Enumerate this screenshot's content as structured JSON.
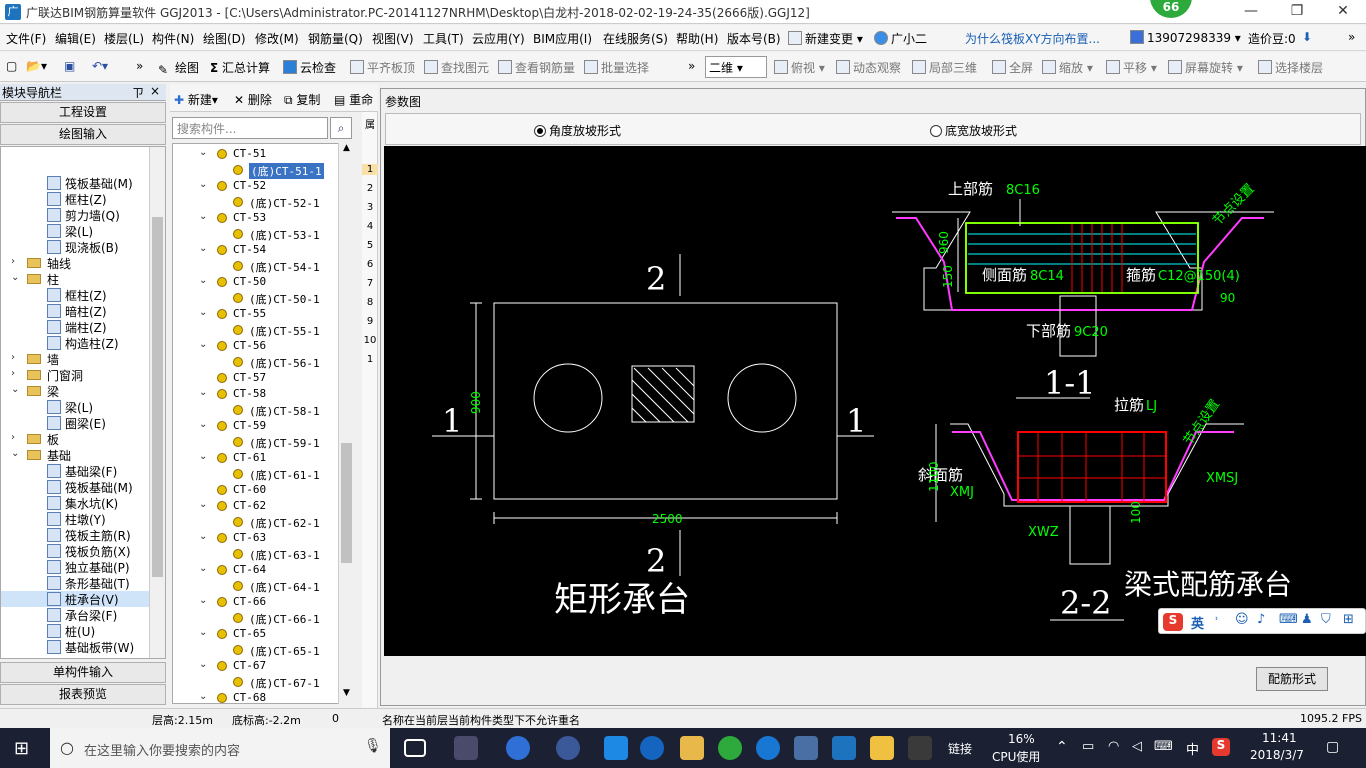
{
  "titlebar": {
    "title": "广联达BIM钢筋算量软件 GGJ2013 - [C:\\Users\\Administrator.PC-20141127NRHM\\Desktop\\白龙村-2018-02-02-19-24-35(2666版).GGJ12]",
    "badge": "66",
    "minimize": "—",
    "restore": "❐",
    "close": "✕"
  },
  "menubar": {
    "items": [
      "文件(F)",
      "编辑(E)",
      "楼层(L)",
      "构件(N)",
      "绘图(D)",
      "修改(M)",
      "钢筋量(Q)",
      "视图(V)",
      "工具(T)",
      "云应用(Y)",
      "BIM应用(I)",
      "在线服务(S)",
      "帮助(H)",
      "版本号(B)"
    ],
    "new_change": "新建变更",
    "assistant": "广小二",
    "question_link": "为什么筏板XY方向布置...",
    "phone": "13907298339",
    "cost_coin": "造价豆:0"
  },
  "toolbar": {
    "draw": "绘图",
    "sum": "汇总计算",
    "cloud_check": "云检查",
    "align_top": "平齐板顶",
    "find_element": "查找图元",
    "view_rebar": "查看钢筋量",
    "batch_select": "批量选择",
    "view_mode": "二维",
    "top_view": "俯视",
    "dynamic": "动态观察",
    "local_3d": "局部三维",
    "fullscreen": "全屏",
    "zoom": "缩放",
    "pan": "平移",
    "rotate": "屏幕旋转",
    "select_floor": "选择楼层"
  },
  "nav": {
    "header": "模块导航栏",
    "pin": "ㄗ",
    "close": "×",
    "project_settings": "工程设置",
    "draw_input": "绘图输入",
    "single_input": "单构件输入",
    "report_preview": "报表预览",
    "tree": [
      {
        "level": 2,
        "type": "item",
        "label": "筏板基础(M)"
      },
      {
        "level": 2,
        "type": "item",
        "label": "框柱(Z)"
      },
      {
        "level": 2,
        "type": "item",
        "label": "剪力墙(Q)"
      },
      {
        "level": 2,
        "type": "item",
        "label": "梁(L)"
      },
      {
        "level": 2,
        "type": "item",
        "label": "现浇板(B)"
      },
      {
        "level": 1,
        "type": "folder",
        "label": "轴线",
        "open": false
      },
      {
        "level": 1,
        "type": "folder",
        "label": "柱",
        "open": true
      },
      {
        "level": 2,
        "type": "item",
        "label": "框柱(Z)"
      },
      {
        "level": 2,
        "type": "item",
        "label": "暗柱(Z)"
      },
      {
        "level": 2,
        "type": "item",
        "label": "端柱(Z)"
      },
      {
        "level": 2,
        "type": "item",
        "label": "构造柱(Z)"
      },
      {
        "level": 1,
        "type": "folder",
        "label": "墙",
        "open": false
      },
      {
        "level": 1,
        "type": "folder",
        "label": "门窗洞",
        "open": false
      },
      {
        "level": 1,
        "type": "folder",
        "label": "梁",
        "open": true
      },
      {
        "level": 2,
        "type": "item",
        "label": "梁(L)"
      },
      {
        "level": 2,
        "type": "item",
        "label": "圈梁(E)"
      },
      {
        "level": 1,
        "type": "folder",
        "label": "板",
        "open": false
      },
      {
        "level": 1,
        "type": "folder",
        "label": "基础",
        "open": true
      },
      {
        "level": 2,
        "type": "item",
        "label": "基础梁(F)"
      },
      {
        "level": 2,
        "type": "item",
        "label": "筏板基础(M)"
      },
      {
        "level": 2,
        "type": "item",
        "label": "集水坑(K)"
      },
      {
        "level": 2,
        "type": "item",
        "label": "柱墩(Y)"
      },
      {
        "level": 2,
        "type": "item",
        "label": "筏板主筋(R)"
      },
      {
        "level": 2,
        "type": "item",
        "label": "筏板负筋(X)"
      },
      {
        "level": 2,
        "type": "item",
        "label": "独立基础(P)"
      },
      {
        "level": 2,
        "type": "item",
        "label": "条形基础(T)"
      },
      {
        "level": 2,
        "type": "item",
        "label": "桩承台(V)",
        "selected": true
      },
      {
        "level": 2,
        "type": "item",
        "label": "承台梁(F)"
      },
      {
        "level": 2,
        "type": "item",
        "label": "桩(U)"
      },
      {
        "level": 2,
        "type": "item",
        "label": "基础板带(W)"
      }
    ]
  },
  "components": {
    "new": "新建",
    "delete": "删除",
    "copy": "复制",
    "rename": "重命",
    "search_placeholder": "搜索构件...",
    "tree": [
      {
        "kind": "parent",
        "label": "CT-51"
      },
      {
        "kind": "child",
        "label": "(底)CT-51-1",
        "selected": true
      },
      {
        "kind": "parent",
        "label": "CT-52"
      },
      {
        "kind": "child",
        "label": "(底)CT-52-1"
      },
      {
        "kind": "parent",
        "label": "CT-53"
      },
      {
        "kind": "child",
        "label": "(底)CT-53-1"
      },
      {
        "kind": "parent",
        "label": "CT-54"
      },
      {
        "kind": "child",
        "label": "(底)CT-54-1"
      },
      {
        "kind": "parent",
        "label": "CT-50"
      },
      {
        "kind": "child",
        "label": "(底)CT-50-1"
      },
      {
        "kind": "parent",
        "label": "CT-55"
      },
      {
        "kind": "child",
        "label": "(底)CT-55-1"
      },
      {
        "kind": "parent",
        "label": "CT-56"
      },
      {
        "kind": "child",
        "label": "(底)CT-56-1"
      },
      {
        "kind": "leaf",
        "label": "CT-57"
      },
      {
        "kind": "parent",
        "label": "CT-58"
      },
      {
        "kind": "child",
        "label": "(底)CT-58-1"
      },
      {
        "kind": "parent",
        "label": "CT-59"
      },
      {
        "kind": "child",
        "label": "(底)CT-59-1"
      },
      {
        "kind": "parent",
        "label": "CT-61"
      },
      {
        "kind": "child",
        "label": "(底)CT-61-1"
      },
      {
        "kind": "leaf",
        "label": "CT-60"
      },
      {
        "kind": "parent",
        "label": "CT-62"
      },
      {
        "kind": "child",
        "label": "(底)CT-62-1"
      },
      {
        "kind": "parent",
        "label": "CT-63"
      },
      {
        "kind": "child",
        "label": "(底)CT-63-1"
      },
      {
        "kind": "parent",
        "label": "CT-64"
      },
      {
        "kind": "child",
        "label": "(底)CT-64-1"
      },
      {
        "kind": "parent",
        "label": "CT-66"
      },
      {
        "kind": "child",
        "label": "(底)CT-66-1"
      },
      {
        "kind": "parent",
        "label": "CT-65"
      },
      {
        "kind": "child",
        "label": "(底)CT-65-1"
      },
      {
        "kind": "parent",
        "label": "CT-67"
      },
      {
        "kind": "child",
        "label": "(底)CT-67-1"
      },
      {
        "kind": "parent",
        "label": "CT-68"
      }
    ]
  },
  "rowstrip": {
    "header": "属",
    "rows": [
      "1",
      "2",
      "3",
      "4",
      "5",
      "6",
      "7",
      "8",
      "9",
      "10",
      "1"
    ]
  },
  "params": {
    "title": "参数图",
    "radio_angle": "角度放坡形式",
    "radio_width": "底宽放坡形式",
    "rebar_form_button": "配筋形式"
  },
  "drawing": {
    "plan_title": "矩形承台",
    "dim_width": "2500",
    "dim_height": "900",
    "mark_1": "1",
    "mark_2": "2",
    "sec1_title": "1-1",
    "sec2_title": "2-2",
    "top_rebar": "上部筋",
    "top_rebar_val": "8C16",
    "side_rebar": "侧面筋",
    "side_rebar_val": "8C14",
    "stirrup": "箍筋",
    "stirrup_val": "C12@150(4)",
    "bottom_rebar": "下部筋",
    "bottom_rebar_val": "9C20",
    "node_setting": "节点设置",
    "dim_960": "960",
    "dim_150": "150",
    "dim_90": "90",
    "tie_bar": "拉筋",
    "tie_bar_val": "LJ",
    "slope_bar": "斜面筋",
    "slope_bar_val": "XMJ",
    "dim_1100": "1100",
    "dim_100": "100",
    "xwz": "XWZ",
    "xmsj": "XMSJ",
    "beam_title": "梁式配筋承台"
  },
  "statusbar": {
    "floor_height": "层高:2.15m",
    "base_height": "底标高:-2.2m",
    "value": "0",
    "message": "名称在当前层当前构件类型下不允许重名",
    "fps": "1095.2 FPS"
  },
  "ime": {
    "label": "英"
  },
  "taskbar": {
    "search_placeholder": "在这里输入你要搜索的内容",
    "links": "链接",
    "cpu_percent": "16%",
    "cpu_label": "CPU使用",
    "lang": "中",
    "time": "11:41",
    "date": "2018/3/7"
  }
}
